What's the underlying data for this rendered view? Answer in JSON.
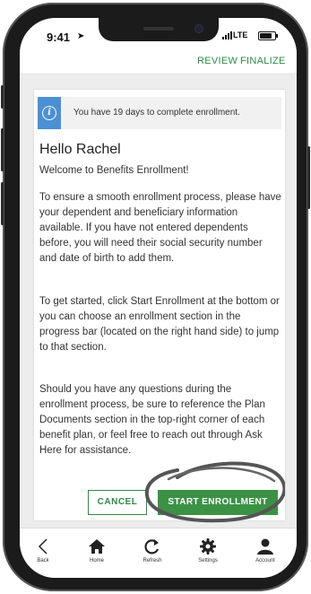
{
  "status_bar": {
    "time": "9:41",
    "network": "LTE"
  },
  "top_nav": {
    "review": "REVIEW",
    "finalize": "FINALIZE"
  },
  "notice": {
    "text": "You have 19 days to complete enrollment."
  },
  "greeting": "Hello Rachel",
  "welcome": "Welcome to Benefits Enrollment!",
  "paragraphs": [
    "To ensure a smooth enrollment process, please have your dependent and beneficiary information available. If you have not entered dependents before, you will need their social security number and date of birth to add them.",
    "To get started, click Start Enrollment at the bottom or you can choose an enrollment section in the progress bar (located on the right hand side) to jump to that section.",
    "Should you have any questions during the enrollment process, be sure to reference the Plan Documents section in the top-right corner of each benefit plan, or feel free to reach out through Ask Here for assistance."
  ],
  "buttons": {
    "cancel": "CANCEL",
    "start": "START ENROLLMENT"
  },
  "tab_bar": [
    {
      "label": "Back",
      "icon": "chevron-left-icon"
    },
    {
      "label": "Home",
      "icon": "home-icon"
    },
    {
      "label": "Refresh",
      "icon": "refresh-icon"
    },
    {
      "label": "Settings",
      "icon": "gear-icon"
    },
    {
      "label": "Account",
      "icon": "person-icon"
    }
  ],
  "colors": {
    "accent_green": "#3b9245",
    "info_blue": "#4a90d4"
  }
}
